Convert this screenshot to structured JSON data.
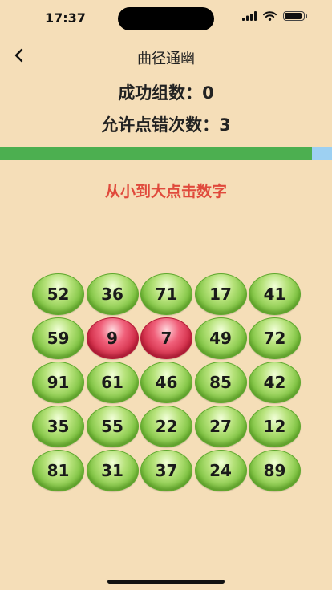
{
  "status_bar": {
    "time": "17:37",
    "battery_level": 0.9
  },
  "nav": {
    "title": "曲径通幽",
    "back_icon": "chevron-left-icon"
  },
  "stats": {
    "success_groups_text": "成功组数：0",
    "allowed_errors_text": "允许点错次数：3"
  },
  "progress": {
    "fraction": 0.94,
    "fill_color": "#4CAF50",
    "track_color": "#9DD0F2"
  },
  "instruction": "从小到大点击数字",
  "grid": {
    "numbers": [
      "52",
      "36",
      "71",
      "17",
      "41",
      "59",
      "9",
      "7",
      "49",
      "72",
      "91",
      "61",
      "46",
      "85",
      "42",
      "35",
      "55",
      "22",
      "27",
      "12",
      "81",
      "31",
      "37",
      "24",
      "89"
    ],
    "highlighted": [
      6,
      7
    ],
    "colors": {
      "normal": "#7CC23F",
      "highlighted": "#D02A45"
    }
  }
}
